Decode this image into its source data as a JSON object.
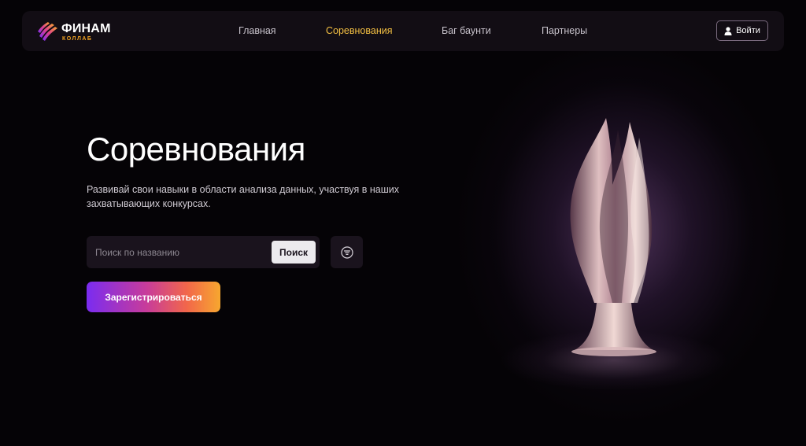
{
  "brand": {
    "name": "ФИНАМ",
    "subtitle": "КОЛЛАБ",
    "accent": "#f4c043"
  },
  "nav": {
    "items": [
      {
        "label": "Главная",
        "active": false
      },
      {
        "label": "Соревнования",
        "active": true
      },
      {
        "label": "Баг баунти",
        "active": false
      },
      {
        "label": "Партнеры",
        "active": false
      }
    ],
    "login_label": "Войти"
  },
  "hero": {
    "title": "Соревнования",
    "subtitle": "Развивай свои навыки в области анализа данных, участвуя в наших захватывающих конкурсах."
  },
  "search": {
    "placeholder": "Поиск по названию",
    "value": "",
    "button_label": "Поиск"
  },
  "register": {
    "label": "Зарегистрироваться"
  },
  "icons": {
    "user": "user-icon",
    "filter": "filter-icon",
    "logo": "finam-logo-icon"
  }
}
